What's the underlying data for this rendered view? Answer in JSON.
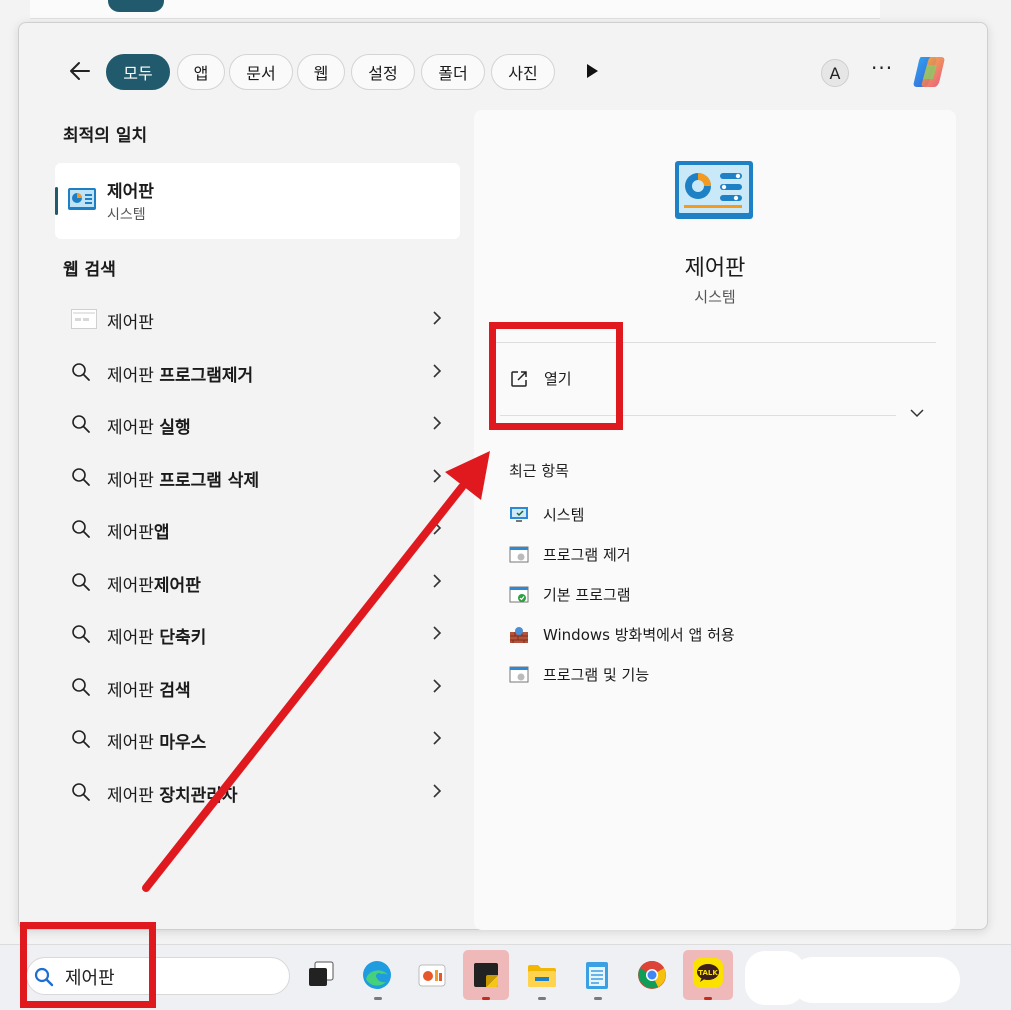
{
  "filters": {
    "tabs": [
      {
        "label": "모두",
        "active": true
      },
      {
        "label": "앱"
      },
      {
        "label": "문서"
      },
      {
        "label": "웹"
      },
      {
        "label": "설정"
      },
      {
        "label": "폴더"
      },
      {
        "label": "사진"
      }
    ],
    "account_initial": "A",
    "more_label": "···"
  },
  "left": {
    "best_match_heading": "최적의 일치",
    "best_match": {
      "title": "제어판",
      "subtitle": "시스템",
      "icon": "control-panel-icon"
    },
    "web_heading": "웹 검색",
    "web_results": [
      {
        "prefix": "제어판",
        "bold": "",
        "icon": "web-page-icon"
      },
      {
        "prefix": "제어판 ",
        "bold": "프로그램제거",
        "icon": "search-icon"
      },
      {
        "prefix": "제어판 ",
        "bold": "실행",
        "icon": "search-icon"
      },
      {
        "prefix": "제어판 ",
        "bold": "프로그램 삭제",
        "icon": "search-icon"
      },
      {
        "prefix": "제어판",
        "bold": "앱",
        "icon": "search-icon"
      },
      {
        "prefix": "제어판",
        "bold": "제어판",
        "icon": "search-icon"
      },
      {
        "prefix": "제어판 ",
        "bold": "단축키",
        "icon": "search-icon"
      },
      {
        "prefix": "제어판 ",
        "bold": "검색",
        "icon": "search-icon"
      },
      {
        "prefix": "제어판 ",
        "bold": "마우스",
        "icon": "search-icon"
      },
      {
        "prefix": "제어판 ",
        "bold": "장치관리자",
        "icon": "search-icon"
      }
    ]
  },
  "right": {
    "title": "제어판",
    "subtitle": "시스템",
    "open_label": "열기",
    "recent_heading": "최근 항목",
    "recent_items": [
      {
        "label": "시스템",
        "icon": "system-monitor-icon"
      },
      {
        "label": "프로그램 제거",
        "icon": "programs-icon"
      },
      {
        "label": "기본 프로그램",
        "icon": "default-programs-icon"
      },
      {
        "label": "Windows 방화벽에서 앱 허용",
        "icon": "firewall-icon"
      },
      {
        "label": "프로그램 및 기능",
        "icon": "programs-features-icon"
      }
    ]
  },
  "taskbar": {
    "search_value": "제어판",
    "apps": [
      "task-view-icon",
      "edge-icon",
      "photos-icon",
      "sticky-notes-icon",
      "file-explorer-icon",
      "notepad-icon",
      "chrome-icon",
      "kakaotalk-icon"
    ],
    "kakao_label": "TALK"
  },
  "colors": {
    "accent": "#215a6c",
    "annotation": "#e0191f"
  }
}
